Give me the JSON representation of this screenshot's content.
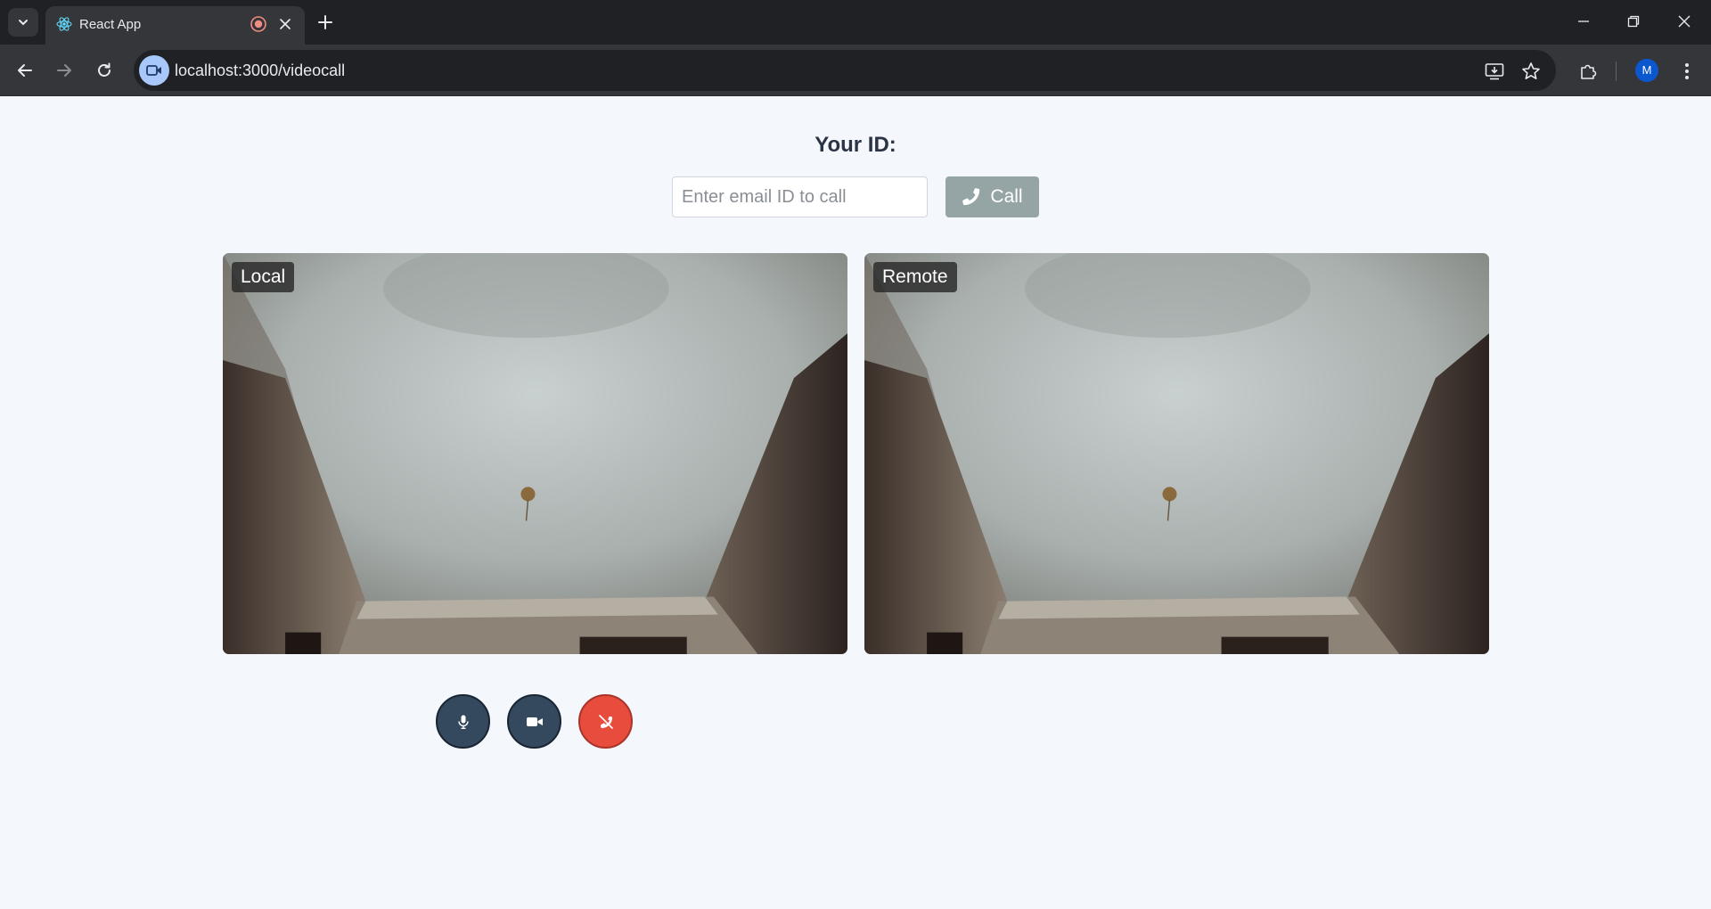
{
  "browser": {
    "tab_title": "React App",
    "url": "localhost:3000/videocall",
    "profile_initial": "M"
  },
  "page": {
    "your_id_label": "Your ID:",
    "call_input": {
      "placeholder": "Enter email ID to call",
      "value": ""
    },
    "call_button_label": "Call",
    "local_label": "Local",
    "remote_label": "Remote",
    "colors": {
      "call_button": "#95a5a6",
      "control_dark": "#34495e",
      "end_call_red": "#e74c3c",
      "background": "#f4f7fb"
    }
  },
  "icons": {
    "tab_search": "chevron-down-icon",
    "favicon": "react-icon",
    "recording": "recording-icon",
    "close": "close-icon",
    "new_tab": "plus-icon",
    "back": "back-arrow-icon",
    "forward": "forward-arrow-icon",
    "reload": "reload-icon",
    "site_info": "video-camera-icon",
    "install": "install-app-icon",
    "bookmark": "star-icon",
    "extensions": "puzzle-icon",
    "menu": "kebab-menu-icon",
    "phone": "phone-icon",
    "mic": "microphone-icon",
    "camera": "video-camera-icon",
    "end_call": "phone-hangup-icon"
  }
}
